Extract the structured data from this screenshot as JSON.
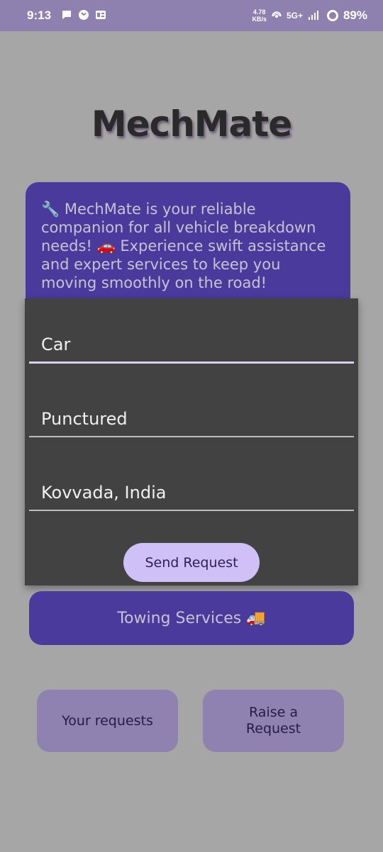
{
  "status_bar": {
    "time": "9:13",
    "left_icons": [
      "chat-icon",
      "phone-clock-icon",
      "id-card-icon"
    ],
    "net_speed_value": "4.78",
    "net_speed_unit": "KB/s",
    "network": "5G+",
    "battery": "89%"
  },
  "app": {
    "title": "MechMate"
  },
  "intro": {
    "text": "🔧 MechMate is your reliable companion for all vehicle breakdown needs! 🚗 Experience swift assistance and expert services to keep you moving smoothly on the road!"
  },
  "form": {
    "vehicle": "Car",
    "issue": "Punctured",
    "location": "Kovvada, India",
    "send_label": "Send Request"
  },
  "towing": {
    "label": "Towing Services 🚚"
  },
  "bottom_actions": {
    "your_requests_label": "Your requests",
    "raise_request_label": "Raise a Request"
  },
  "colors": {
    "background": "#a6a6a6",
    "status_bar": "#8e81b0",
    "card_purple": "#4a3a9c",
    "panel_dark": "#424242",
    "button_light": "#cfc0f7",
    "button_muted": "#8f82b0"
  }
}
